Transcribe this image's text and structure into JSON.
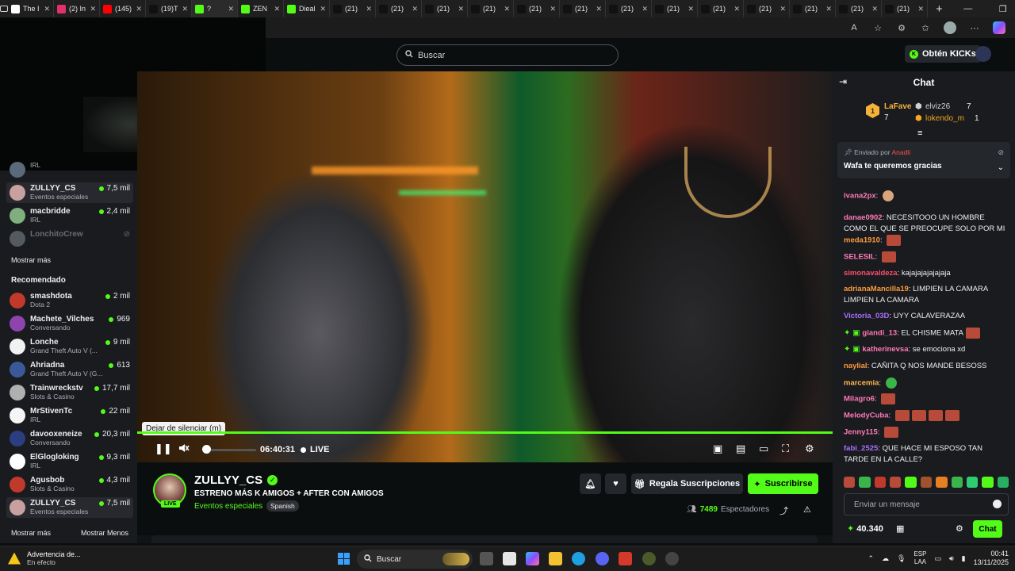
{
  "browser": {
    "tabs": [
      {
        "label": "The I",
        "icon": "tab-logo-icon",
        "color": "#ffffff"
      },
      {
        "label": "(2) In",
        "icon": "instagram-icon",
        "color": "#e1306c"
      },
      {
        "label": "(145)",
        "icon": "youtube-icon",
        "color": "#ff0000"
      },
      {
        "label": "(19)T",
        "icon": "tiktok-icon",
        "color": "#111111"
      },
      {
        "label": "?",
        "icon": "kick-icon",
        "color": "#53fc18"
      },
      {
        "label": "ZEN",
        "icon": "kick-icon",
        "color": "#53fc18"
      },
      {
        "label": "Dieal",
        "icon": "kick-icon",
        "color": "#53fc18"
      },
      {
        "label": "(21)",
        "icon": "tiktok-icon",
        "color": "#111111"
      },
      {
        "label": "(21)",
        "icon": "tiktok-icon",
        "color": "#111111"
      },
      {
        "label": "(21)",
        "icon": "tiktok-icon",
        "color": "#111111"
      },
      {
        "label": "(21)",
        "icon": "tiktok-icon",
        "color": "#111111"
      },
      {
        "label": "(21)",
        "icon": "tiktok-icon",
        "color": "#111111"
      },
      {
        "label": "(21)",
        "icon": "tiktok-icon",
        "color": "#111111"
      },
      {
        "label": "(21)",
        "icon": "tiktok-icon",
        "color": "#111111"
      },
      {
        "label": "(21)",
        "icon": "tiktok-icon",
        "color": "#111111"
      },
      {
        "label": "(21)",
        "icon": "tiktok-icon",
        "color": "#111111"
      },
      {
        "label": "(21)",
        "icon": "tiktok-icon",
        "color": "#111111"
      },
      {
        "label": "(21)",
        "icon": "tiktok-icon",
        "color": "#111111"
      },
      {
        "label": "(21)",
        "icon": "tiktok-icon",
        "color": "#111111"
      },
      {
        "label": "(21)",
        "icon": "tiktok-icon",
        "color": "#111111"
      }
    ],
    "new_tab": "+"
  },
  "header": {
    "search_placeholder": "Buscar",
    "kicks_button": "Obtén KICKs"
  },
  "sidebar": {
    "top_items": [
      {
        "name": "",
        "category": "IRL",
        "viewers": "",
        "color": "#5a6a7a"
      },
      {
        "name": "ZULLYY_CS",
        "category": "Eventos especiales",
        "viewers": "7,5 mil",
        "color": "#c9a0a0",
        "selected": true
      },
      {
        "name": "macbridde",
        "category": "IRL",
        "viewers": "2,4 mil",
        "color": "#7fae7f"
      },
      {
        "name": "LonchitoCrew",
        "category": "",
        "viewers": "",
        "color": "#555a60",
        "offline": true
      }
    ],
    "show_more_1": "Mostrar más",
    "recommended_heading": "Recomendado",
    "recommended": [
      {
        "name": "smashdota",
        "category": "Dota 2",
        "viewers": "2 mil",
        "color": "#c0392b"
      },
      {
        "name": "Machete_Vilches",
        "category": "Conversando",
        "viewers": "969",
        "color": "#8e44ad"
      },
      {
        "name": "Lonche",
        "category": "Grand Theft Auto V (...",
        "viewers": "9 mil",
        "color": "#f1f1f1"
      },
      {
        "name": "Ahriadna",
        "category": "Grand Theft Auto V (G...",
        "viewers": "613",
        "color": "#3b5998"
      },
      {
        "name": "Trainwreckstv",
        "category": "Slots & Casino",
        "viewers": "17,7 mil",
        "color": "#b0b0b0"
      },
      {
        "name": "MrStivenTc",
        "category": "IRL",
        "viewers": "22 mil",
        "color": "#f5f5f5"
      },
      {
        "name": "davooxeneize",
        "category": "Conversando",
        "viewers": "20,3 mil",
        "color": "#2c3e80"
      },
      {
        "name": "ElGlogloking",
        "category": "IRL",
        "viewers": "9,3 mil",
        "color": "#ffffff"
      },
      {
        "name": "Agusbob",
        "category": "Slots & Casino",
        "viewers": "4,3 mil",
        "color": "#c0392b"
      },
      {
        "name": "ZULLYY_CS",
        "category": "Eventos especiales",
        "viewers": "7,5 mil",
        "color": "#c9a0a0",
        "selected": true
      }
    ],
    "show_more_2": "Mostrar más",
    "show_less": "Mostrar Menos"
  },
  "player": {
    "tooltip": "Dejar de silenciar (m)",
    "time": "06:40:31",
    "live_label": "LIVE",
    "volume_level": 0
  },
  "channel": {
    "name": "ZULLYY_CS",
    "live_badge": "LIVE",
    "title": "ESTRENO MÁS K AMIGOS + AFTER CON AMIGOS",
    "category": "Eventos especiales",
    "language": "Spanish",
    "gift_button": "Regala Suscripciones",
    "subscribe_button": "Suscribirse",
    "viewers_count": "7489",
    "viewers_label": "Espectadores"
  },
  "chat": {
    "title": "Chat",
    "leaderboard": [
      {
        "user": "LaFave",
        "count": "7",
        "rank": "1"
      },
      {
        "user": "elviz26",
        "count": "7"
      },
      {
        "user": "lokendo_m",
        "count": "1"
      }
    ],
    "pinned_by_label": "Enviado por",
    "pinned_by_user": "Anadli",
    "pinned_message": "Wafa te queremos gracias",
    "messages": [
      {
        "user": "ivana2px",
        "color": "#ff7ab8",
        "text": ""
      },
      {
        "user": "danae0902",
        "color": "#ff7ab8",
        "text": "NECESITOOO UN HOMBRE COMO EL QUE SE PREOCUPE SOLO POR MI"
      },
      {
        "user": "meda1910",
        "color": "#ff9a3c",
        "text": ""
      },
      {
        "user": "SELESIL",
        "color": "#ff7ab8",
        "text": ""
      },
      {
        "user": "simonavaldeza",
        "color": "#ff4d6d",
        "text": "kajajajajajajaja"
      },
      {
        "user": "adrianaMancilla19",
        "color": "#ff9a3c",
        "text": "LIMPIEN LA CAMARA LIMPIEN LA CAMARA"
      },
      {
        "user": "Victoria_03D",
        "color": "#a970ff",
        "text": "UYY CALAVERAZAA"
      },
      {
        "user": "giandi_13",
        "color": "#ff7ab8",
        "text": "EL CHISME MATA"
      },
      {
        "user": "katherinevsa",
        "color": "#ff7ab8",
        "text": "se emociona xd"
      },
      {
        "user": "naylial",
        "color": "#ff9a3c",
        "text": "CAÑITA Q NOS MANDE BESOSS"
      },
      {
        "user": "marcemia",
        "color": "#ffb84d",
        "text": ""
      },
      {
        "user": "Milagro6",
        "color": "#ff7ab8",
        "text": ""
      },
      {
        "user": "MelodyCuba",
        "color": "#ff7ab8",
        "text": ""
      },
      {
        "user": "Jenny115",
        "color": "#ff7ab8",
        "text": ""
      },
      {
        "user": "fabi_2525",
        "color": "#a970ff",
        "text": "QUE HACE MI ESPOSO TAN TARDE EN LA CALLE?"
      }
    ],
    "input_placeholder": "Enviar un mensaje",
    "points": "40.340",
    "send_button": "Chat"
  },
  "taskbar": {
    "warning_title": "Advertencia de...",
    "warning_sub": "En efecto",
    "search_placeholder": "Buscar",
    "lang_line1": "ESP",
    "lang_line2": "LAA",
    "clock_time": "00:41",
    "clock_date": "13/11/2025"
  }
}
